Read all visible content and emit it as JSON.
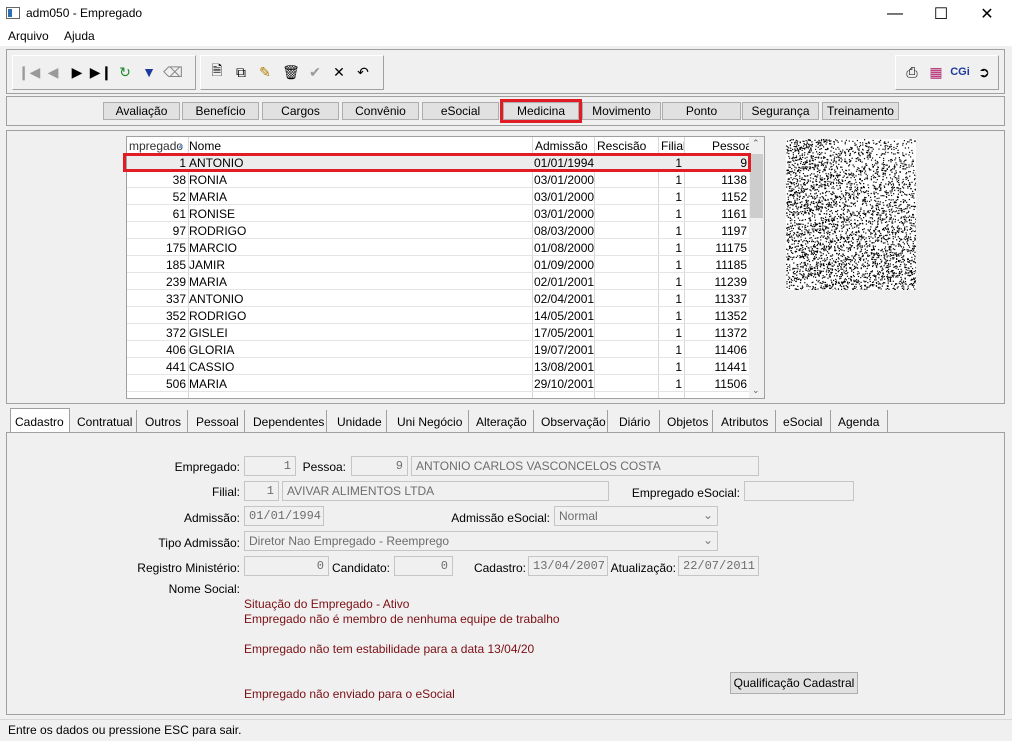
{
  "window": {
    "title": "adm050 - Empregado"
  },
  "menu": [
    "Arquivo",
    "Ajuda"
  ],
  "toolbar_right": {
    "cgi_label": "CGi"
  },
  "modules": [
    "Avaliação",
    "Benefício",
    "Cargos",
    "Convênio",
    "eSocial",
    "Medicina",
    "Movimento",
    "Ponto",
    "Segurança",
    "Treinamento"
  ],
  "active_module": "Medicina",
  "grid": {
    "headers": {
      "empregado": "mpregado",
      "nome": "Nome",
      "admissao": "Admissão",
      "rescisao": "Rescisão",
      "filial": "Filial",
      "pessoa": "Pessoa"
    },
    "rows": [
      {
        "empregado": "1",
        "nome": "ANTONIO",
        "admissao": "01/01/1994",
        "rescisao": "",
        "filial": "1",
        "pessoa": "9"
      },
      {
        "empregado": "38",
        "nome": "RONIA",
        "admissao": "03/01/2000",
        "rescisao": "",
        "filial": "1",
        "pessoa": "1138"
      },
      {
        "empregado": "52",
        "nome": "MARIA",
        "admissao": "03/01/2000",
        "rescisao": "",
        "filial": "1",
        "pessoa": "1152"
      },
      {
        "empregado": "61",
        "nome": "RONISE",
        "admissao": "03/01/2000",
        "rescisao": "",
        "filial": "1",
        "pessoa": "1161"
      },
      {
        "empregado": "97",
        "nome": "RODRIGO",
        "admissao": "08/03/2000",
        "rescisao": "",
        "filial": "1",
        "pessoa": "1197"
      },
      {
        "empregado": "175",
        "nome": "MARCIO",
        "admissao": "01/08/2000",
        "rescisao": "",
        "filial": "1",
        "pessoa": "11175"
      },
      {
        "empregado": "185",
        "nome": "JAMIR",
        "admissao": "01/09/2000",
        "rescisao": "",
        "filial": "1",
        "pessoa": "11185"
      },
      {
        "empregado": "239",
        "nome": "MARIA",
        "admissao": "02/01/2001",
        "rescisao": "",
        "filial": "1",
        "pessoa": "11239"
      },
      {
        "empregado": "337",
        "nome": "ANTONIO",
        "admissao": "02/04/2001",
        "rescisao": "",
        "filial": "1",
        "pessoa": "11337"
      },
      {
        "empregado": "352",
        "nome": "RODRIGO",
        "admissao": "14/05/2001",
        "rescisao": "",
        "filial": "1",
        "pessoa": "11352"
      },
      {
        "empregado": "372",
        "nome": "GISLEI",
        "admissao": "17/05/2001",
        "rescisao": "",
        "filial": "1",
        "pessoa": "11372"
      },
      {
        "empregado": "406",
        "nome": "GLORIA",
        "admissao": "19/07/2001",
        "rescisao": "",
        "filial": "1",
        "pessoa": "11406"
      },
      {
        "empregado": "441",
        "nome": "CASSIO",
        "admissao": "13/08/2001",
        "rescisao": "",
        "filial": "1",
        "pessoa": "11441"
      },
      {
        "empregado": "506",
        "nome": "MARIA",
        "admissao": "29/10/2001",
        "rescisao": "",
        "filial": "1",
        "pessoa": "11506"
      }
    ]
  },
  "tabs": [
    "Cadastro",
    "Contratual",
    "Outros",
    "Pessoal",
    "Dependentes",
    "Unidade",
    "Uni Negócio",
    "Alteração",
    "Observação",
    "Diário",
    "Objetos",
    "Atributos",
    "eSocial",
    "Agenda"
  ],
  "active_tab": "Cadastro",
  "form": {
    "empregado_label": "Empregado:",
    "empregado": "1",
    "pessoa_label": "Pessoa:",
    "pessoa": "9",
    "pessoa_nome": "ANTONIO CARLOS VASCONCELOS COSTA",
    "filial_label": "Filial:",
    "filial": "1",
    "filial_nome": "AVIVAR ALIMENTOS LTDA",
    "empregado_esocial_label": "Empregado eSocial:",
    "empregado_esocial": "",
    "admissao_label": "Admissão:",
    "admissao": "01/01/1994",
    "admissao_esocial_label": "Admissão eSocial:",
    "admissao_esocial": "Normal",
    "tipo_admissao_label": "Tipo Admissão:",
    "tipo_admissao": "Diretor Nao Empregado - Reemprego",
    "registro_label": "Registro Ministério:",
    "registro": "0",
    "candidato_label": "Candidato:",
    "candidato": "0",
    "cadastro_label": "Cadastro:",
    "cadastro": "13/04/2007",
    "atualizacao_label": "Atualização:",
    "atualizacao": "22/07/2011",
    "nome_social_label": "Nome Social:"
  },
  "messages": {
    "situacao": "Situação do Empregado - Ativo",
    "equipe": "Empregado não é membro de nenhuma equipe de trabalho",
    "estabilidade": "Empregado não tem estabilidade para a data 13/04/20",
    "esocial": "Empregado não enviado para o eSocial"
  },
  "qualificacao_button": "Qualificação Cadastral",
  "status": "Entre os dados ou pressione ESC para sair."
}
